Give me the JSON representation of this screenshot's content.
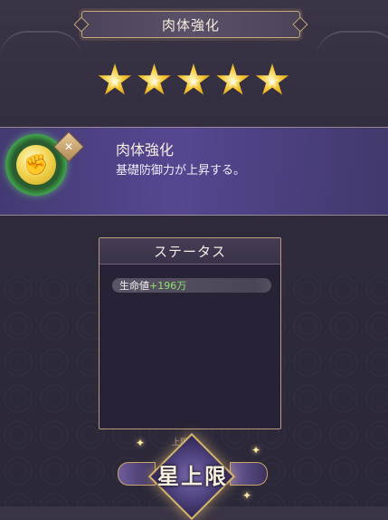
{
  "header": {
    "title": "肉体強化"
  },
  "rating": {
    "stars": 5,
    "max_stars": 5
  },
  "skill": {
    "name": "肉体強化",
    "description": "基礎防御力が上昇する。",
    "icon": "arm-strength-icon",
    "badge_icon": "sword-badge-icon"
  },
  "status": {
    "title": "ステータス",
    "rows": [
      {
        "label": "生命値",
        "value": "+196万"
      }
    ]
  },
  "footer": {
    "subtitle": "上限",
    "button_label": "星上限"
  },
  "colors": {
    "accent_gold": "#c9a979",
    "panel_purple": "#584896",
    "value_green": "#8ee36b"
  }
}
